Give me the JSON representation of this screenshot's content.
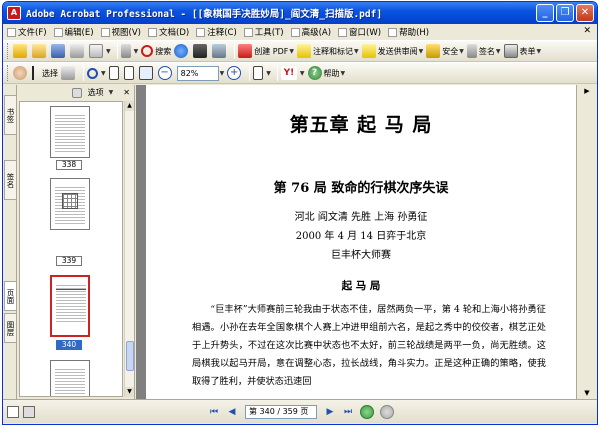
{
  "window": {
    "title": "Adobe Acrobat Professional - [[象棋国手决胜妙局]_阎文清_扫描版.pdf]"
  },
  "menu": [
    {
      "label": "文件(F)"
    },
    {
      "label": "编辑(E)"
    },
    {
      "label": "视图(V)"
    },
    {
      "label": "文档(D)"
    },
    {
      "label": "注释(C)"
    },
    {
      "label": "工具(T)"
    },
    {
      "label": "高级(A)"
    },
    {
      "label": "窗口(W)"
    },
    {
      "label": "帮助(H)"
    }
  ],
  "toolbar1": {
    "search_label": "搜索",
    "create_pdf": "创建 PDF",
    "comment": "注释和标记",
    "review": "发送供审阅",
    "secure": "安全",
    "sign": "签名",
    "forms": "表单"
  },
  "toolbar2": {
    "select_label": "选择",
    "zoom_value": "82%",
    "help_label": "帮助"
  },
  "nav_tabs": {
    "bookmarks": "书签",
    "signatures": "签名",
    "pages": "页面",
    "layers": "图层"
  },
  "panel": {
    "options_label": "选项",
    "thumbnails": [
      {
        "page": "338"
      },
      {
        "page": "339"
      },
      {
        "page": "340"
      }
    ]
  },
  "document": {
    "chapter_title": "第五章  起 马 局",
    "game_title": "第 76 局   致命的行棋次序失误",
    "players": "河北  阎文清  先胜  上海  孙勇征",
    "date_place": "2000 年 4 月 14 日弈于北京",
    "event": "巨丰杯大师赛",
    "opening": "起 马 局",
    "paragraph": "“巨丰杯”大师赛前三轮我由于状态不佳，居然两负一平，第 4 轮和上海小将孙勇征相遇。小孙在去年全国象棋个人赛上冲进甲组前六名，是起之秀中的佼佼者，棋艺正处于上升势头，不过在这次比赛中状态也不太好，前三轮战绩是两平一负，尚无胜绩。这局棋我以起马开局，意在调整心态，拉长战线，角斗实力。正是这种正确的策略，使我取得了胜利，并使状态迅速回"
  },
  "statusbar": {
    "page_indicator": "第 340 / 359 页"
  },
  "colors": {
    "titlebar": "#0a55e0",
    "selected_page": "#316ac5",
    "doc_background": "#808080"
  }
}
